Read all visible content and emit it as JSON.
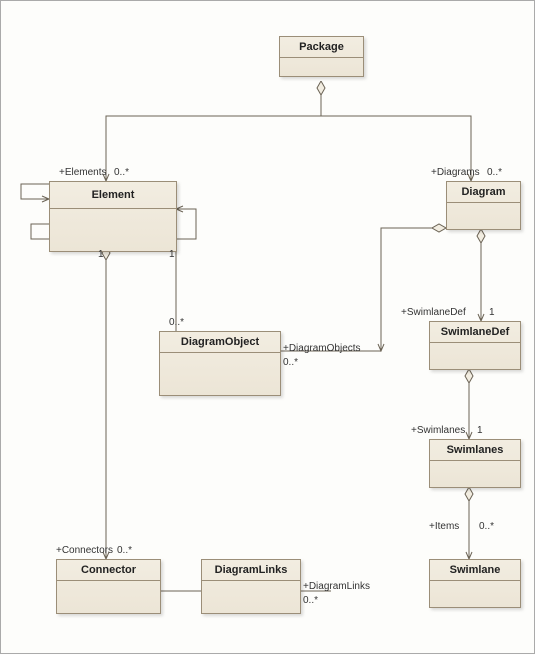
{
  "classes": {
    "package": "Package",
    "element": "Element",
    "diagram": "Diagram",
    "diagramObject": "DiagramObject",
    "swimlaneDef": "SwimlaneDef",
    "swimlanes": "Swimlanes",
    "swimlane": "Swimlane",
    "connector": "Connector",
    "diagramLinks": "DiagramLinks"
  },
  "relations": {
    "packageElements": {
      "role": "+Elements",
      "mult": "0..*"
    },
    "packageDiagrams": {
      "role": "+Diagrams",
      "mult": "0..*"
    },
    "elementDiagObj": {
      "elementMult": "1",
      "objMult": "0..*"
    },
    "diagramDiagObj": {
      "role": "+DiagramObjects",
      "mult": "0..*"
    },
    "elementSelf": {
      "elementMult2": "1"
    },
    "diagramSwimlaneDef": {
      "role": "+SwimlaneDef",
      "mult": "1"
    },
    "swimlanedefSwimlanes": {
      "role": "+Swimlanes",
      "mult": "1"
    },
    "swimlanesSwimlane": {
      "role": "+Items",
      "mult": "0..*"
    },
    "elementConnectors": {
      "role": "+Connectors",
      "mult": "0..*"
    },
    "connectorDiagLinks": {
      "role": "+DiagramLinks",
      "mult": "0..*"
    }
  }
}
